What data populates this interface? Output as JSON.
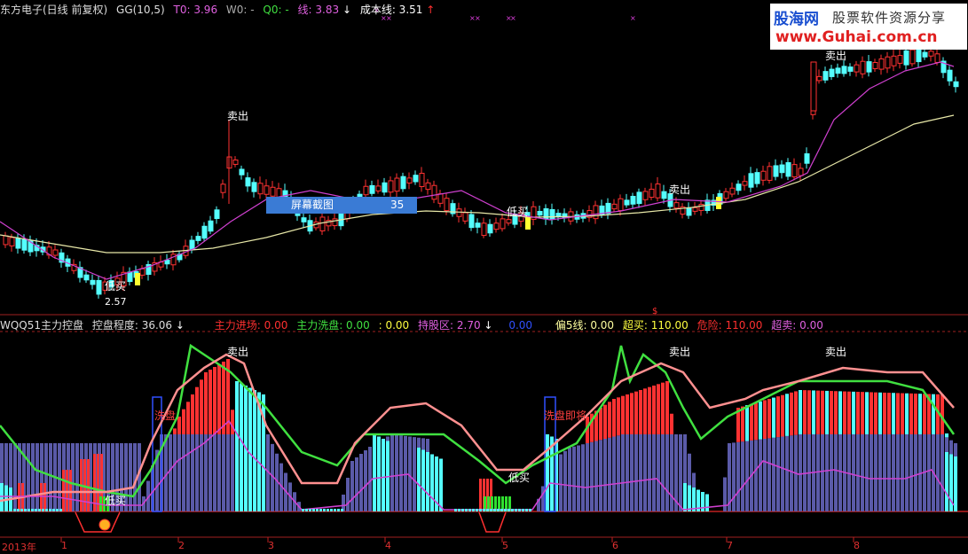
{
  "header": {
    "stock": "东方电子(日线 前复权)",
    "gg": "GG(10,5)",
    "t0": "T0: 3.96",
    "w0": "W0: -",
    "q0": "Q0: -",
    "line": "线: 3.83",
    "line_arrow": "↓",
    "cost": "成本线: 3.51",
    "cost_arrow": "↑"
  },
  "logo": {
    "name": "股海网",
    "slogan": "股票软件资源分享",
    "url": "www.Guhai.com.cn"
  },
  "popup": {
    "label": "屏幕截图",
    "value": "35"
  },
  "price_labels": {
    "sell1": "卖出",
    "sell2": "卖出",
    "low_buy1": "低买",
    "low_buy2": "低买",
    "sell3": "卖出",
    "low_price": "2.57"
  },
  "indicator_header": {
    "name": "WQQ51主力控盘",
    "control": "控盘程度: 36.06",
    "control_arrow": "↓",
    "main_in": "主力进场: 0.00",
    "main_wash": "主力洗盘: 0.00",
    "colon": ": 0.00",
    "hold": "持股区: 2.70",
    "hold_arrow": "↓",
    "blue": "0.00",
    "bias5": "偏5线: 0.00",
    "overbuy": "超买: 110.00",
    "danger": "危险: 110.00",
    "oversell": "超卖: 0.00"
  },
  "indicator_labels": {
    "sell1": "卖出",
    "sell2": "卖出",
    "sell3": "卖出",
    "low_buy1": "低买",
    "low_buy2": "低买",
    "wash1": "洗盘",
    "wash2": "洗盘即将"
  },
  "dates": [
    "2013年",
    "1",
    "2",
    "3",
    "4",
    "5",
    "6",
    "7",
    "8"
  ],
  "colors": {
    "up": "#ff3232",
    "down": "#54ffff",
    "ma1": "#d040d0",
    "ma2": "#e0e0a0",
    "green": "#40e040",
    "slate": "#5a5aa8"
  }
}
